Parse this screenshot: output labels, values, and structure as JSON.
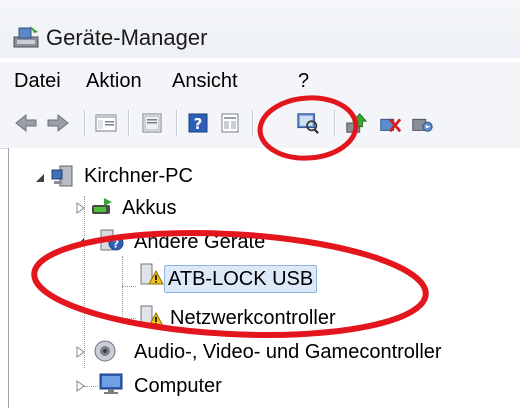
{
  "window": {
    "title": "Geräte-Manager",
    "icon": "device-manager-icon"
  },
  "menu": {
    "items": [
      "Datei",
      "Aktion",
      "Ansicht",
      "?"
    ]
  },
  "toolbar": {
    "buttons": [
      "back-arrow-icon",
      "forward-arrow-icon",
      "show-hide-console-tree-icon",
      "properties-icon",
      "help-icon",
      "view-icon",
      "scan-hardware-icon",
      "update-driver-icon",
      "uninstall-icon",
      "disable-device-icon"
    ]
  },
  "tree": {
    "root": "Kirchner-PC",
    "akkus": "Akkus",
    "andere": "Andere Geräte",
    "atb": "ATB-LOCK USB",
    "netz": "Netzwerkcontroller",
    "audio": "Audio-, Video- und Gamecontroller",
    "computer": "Computer"
  },
  "annotations": {
    "color": "#e4161d"
  }
}
